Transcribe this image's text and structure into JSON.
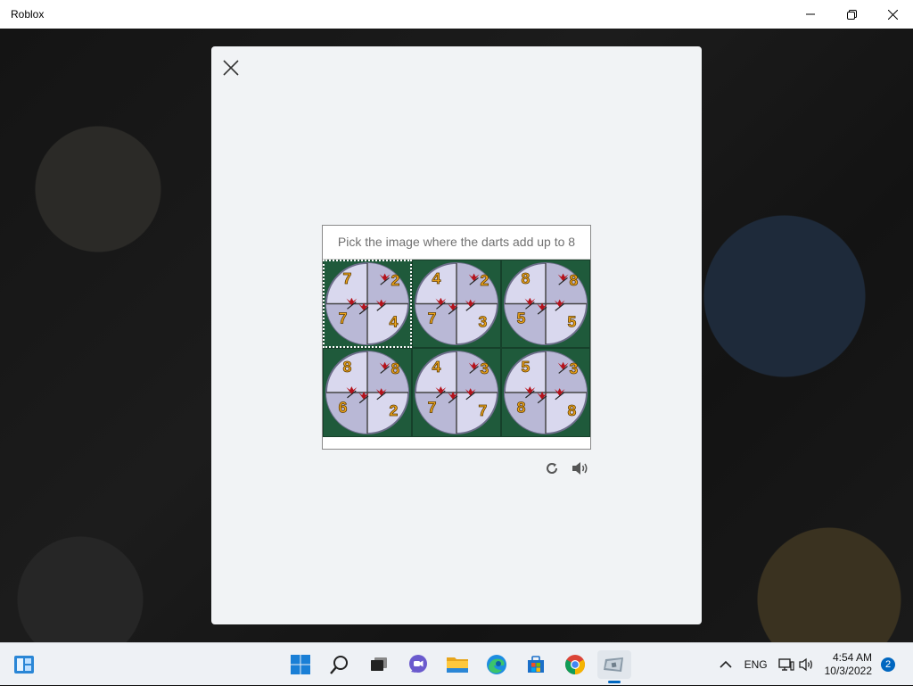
{
  "window": {
    "title": "Roblox"
  },
  "captcha": {
    "prompt": "Pick the image where the darts add up to 8",
    "tiles": [
      {
        "numbers": [
          "7",
          "2",
          "7",
          "4"
        ]
      },
      {
        "numbers": [
          "4",
          "2",
          "7",
          "3"
        ]
      },
      {
        "numbers": [
          "8",
          "8",
          "5",
          "5"
        ]
      },
      {
        "numbers": [
          "8",
          "8",
          "6",
          "2"
        ]
      },
      {
        "numbers": [
          "4",
          "3",
          "7",
          "7"
        ]
      },
      {
        "numbers": [
          "5",
          "3",
          "8",
          "8"
        ]
      }
    ]
  },
  "taskbar": {
    "apps": [
      "start-icon",
      "search-icon",
      "task-view-icon",
      "chat-icon",
      "file-explorer-icon",
      "edge-icon",
      "store-icon",
      "chrome-icon",
      "roblox-icon"
    ],
    "language": "ENG",
    "time": "4:54 AM",
    "date": "10/3/2022",
    "notification_count": "2"
  },
  "colors": {
    "accent": "#0067c0",
    "number": "#f2a71b",
    "dart": "#b5121b",
    "board": "#1f5a3b"
  }
}
